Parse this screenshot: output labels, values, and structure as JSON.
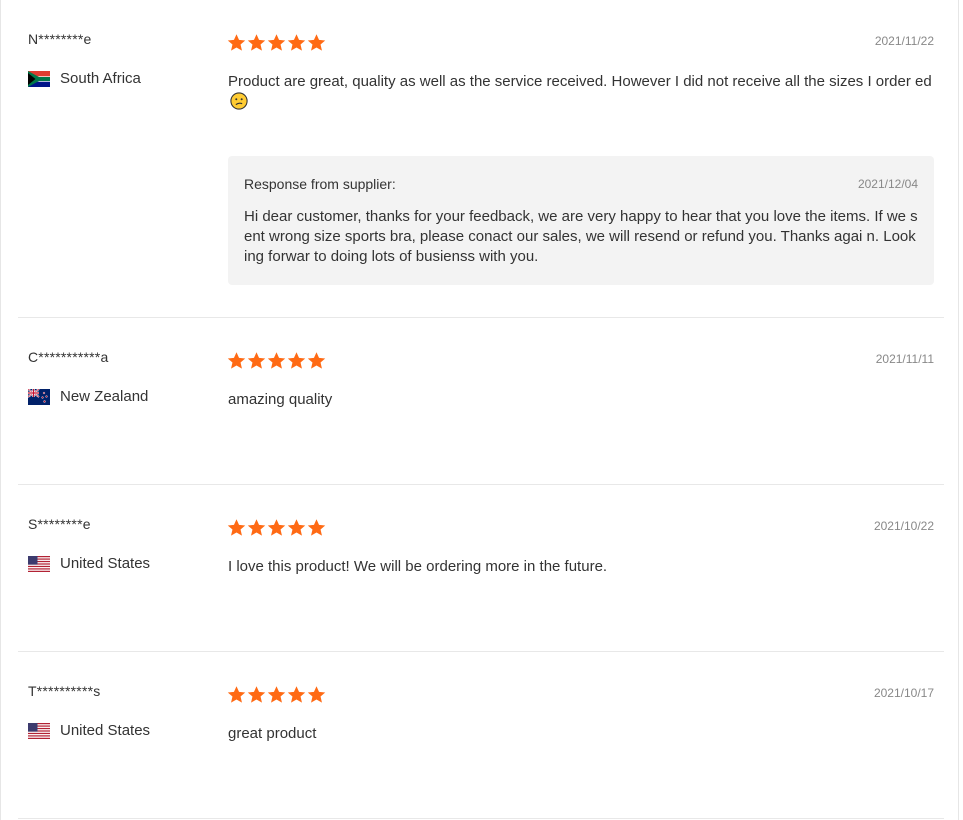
{
  "colors": {
    "star": "#ff6a14",
    "border": "#e8e8e8",
    "response_bg": "#f3f3f3"
  },
  "reviews": [
    {
      "name": "N********e",
      "country": "South Africa",
      "flag": "south-africa-flag-icon",
      "rating": 5,
      "date": "2021/11/22",
      "text": "Product are great, quality as well as the service received. However I did not receive all the sizes I order ed",
      "emoji": "confused-face-icon",
      "response": {
        "title": "Response from supplier:",
        "date": "2021/12/04",
        "text": "Hi dear customer, thanks for your feedback, we are very happy to hear that you love the items. If we sent wrong size sports bra, please conact our sales, we will resend or refund you. Thanks agai n. Looking forwar to doing lots of busienss with you."
      }
    },
    {
      "name": "C***********a",
      "country": "New Zealand",
      "flag": "new-zealand-flag-icon",
      "rating": 5,
      "date": "2021/11/11",
      "text": "amazing quality"
    },
    {
      "name": "S********e",
      "country": "United States",
      "flag": "united-states-flag-icon",
      "rating": 5,
      "date": "2021/10/22",
      "text": "I love this product! We will be ordering more in the future."
    },
    {
      "name": "T**********s",
      "country": "United States",
      "flag": "united-states-flag-icon",
      "rating": 5,
      "date": "2021/10/17",
      "text": "great product"
    }
  ]
}
